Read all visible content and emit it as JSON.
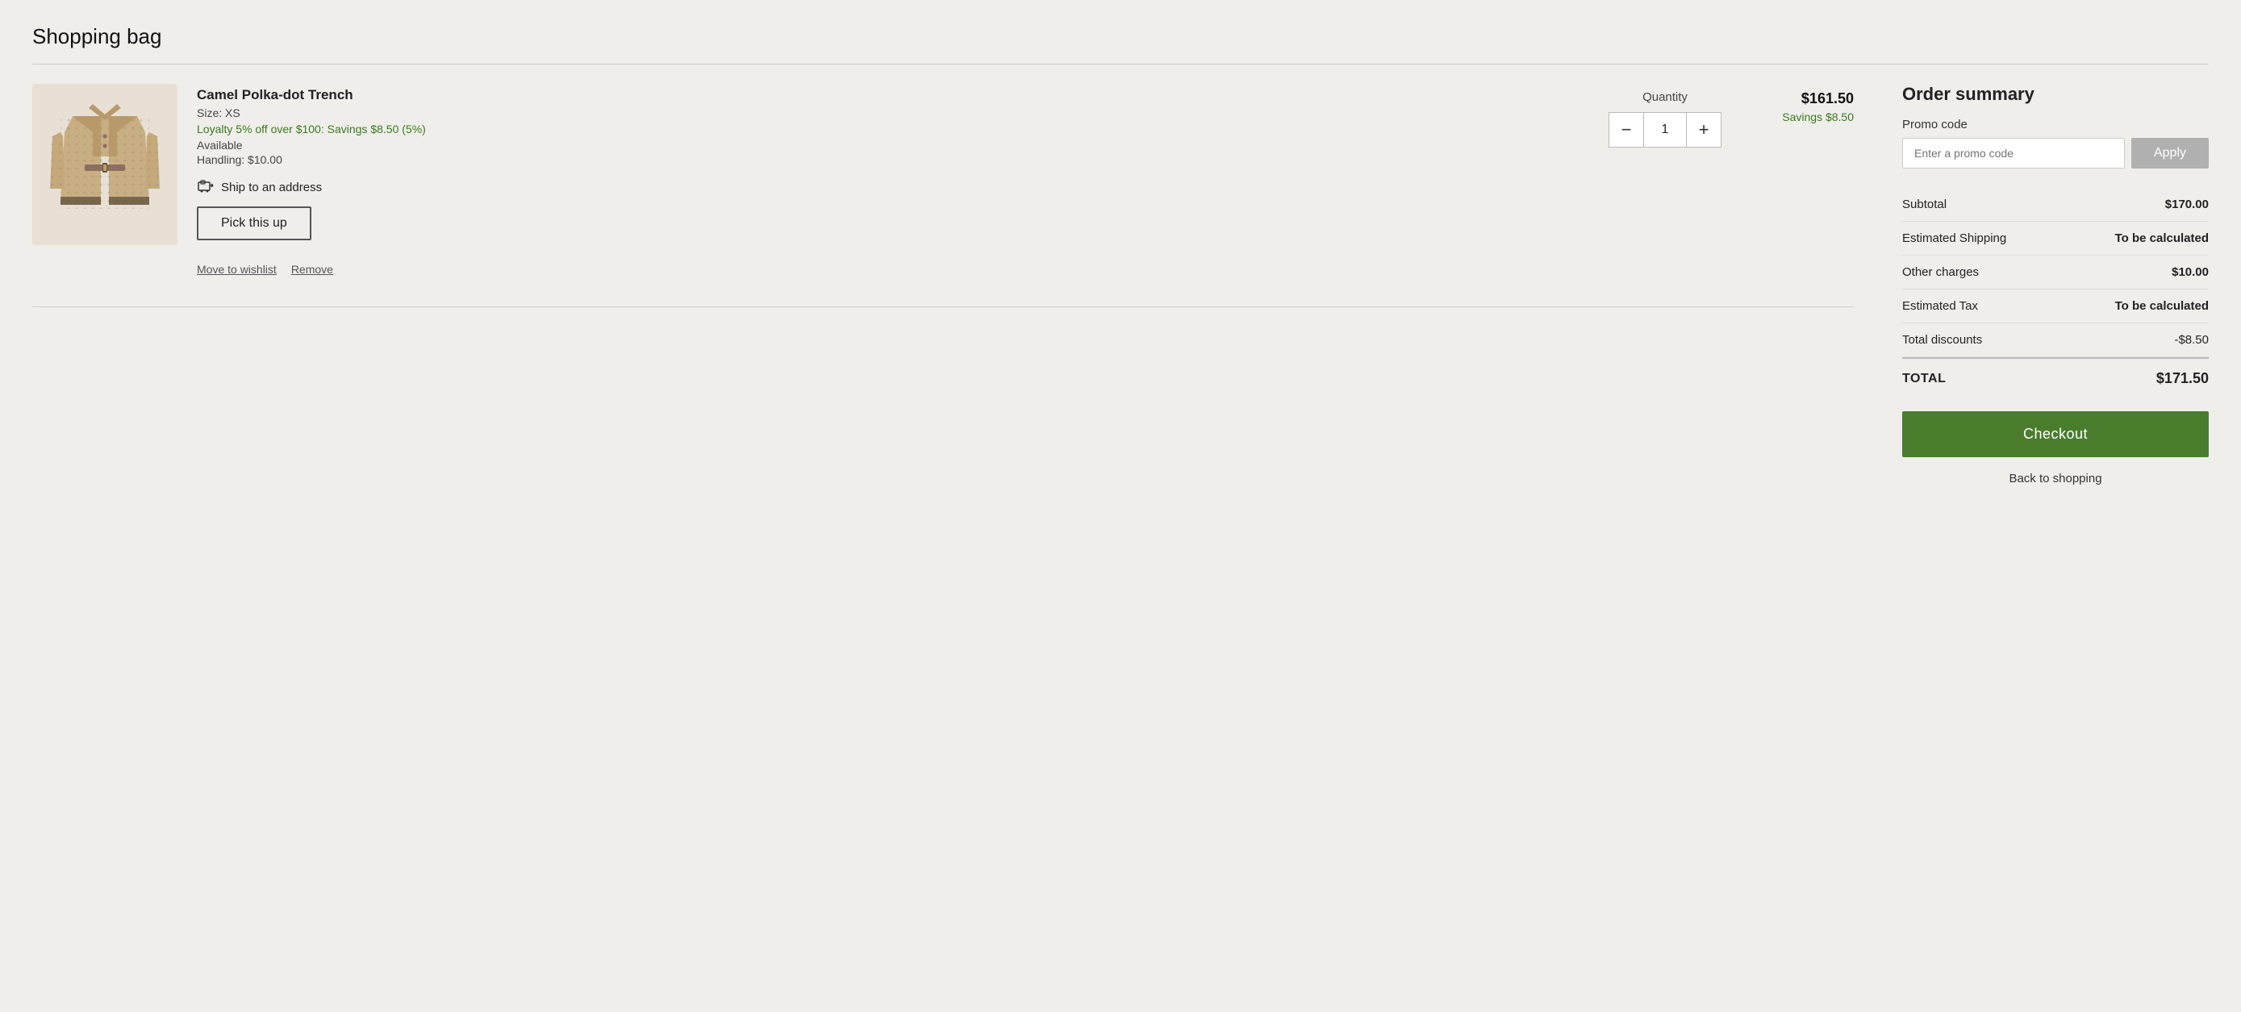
{
  "page": {
    "title": "Shopping bag"
  },
  "cart": {
    "item": {
      "name": "Camel Polka-dot Trench",
      "size_label": "Size: XS",
      "loyalty_text": "Loyalty 5% off over $100: Savings $8.50 (5%)",
      "available_text": "Available",
      "handling_text": "Handling: $10.00",
      "ship_label": "Ship to an address",
      "pickup_label": "Pick this up",
      "quantity_label": "Quantity",
      "quantity_value": "1",
      "qty_minus": "−",
      "qty_plus": "+",
      "price": "$161.50",
      "savings": "Savings $8.50",
      "move_wishlist": "Move to wishlist",
      "remove": "Remove"
    }
  },
  "order_summary": {
    "title": "Order summary",
    "promo_label": "Promo code",
    "promo_placeholder": "Enter a promo code",
    "apply_label": "Apply",
    "rows": [
      {
        "label": "Subtotal",
        "value": "$170.00",
        "bold": true
      },
      {
        "label": "Estimated Shipping",
        "value": "To be calculated",
        "bold": true
      },
      {
        "label": "Other charges",
        "value": "$10.00",
        "bold": true
      },
      {
        "label": "Estimated Tax",
        "value": "To be calculated",
        "bold": true
      },
      {
        "label": "Total discounts",
        "value": "-$8.50",
        "bold": false
      }
    ],
    "total_label": "TOTAL",
    "total_value": "$171.50",
    "checkout_label": "Checkout",
    "back_label": "Back to shopping"
  }
}
